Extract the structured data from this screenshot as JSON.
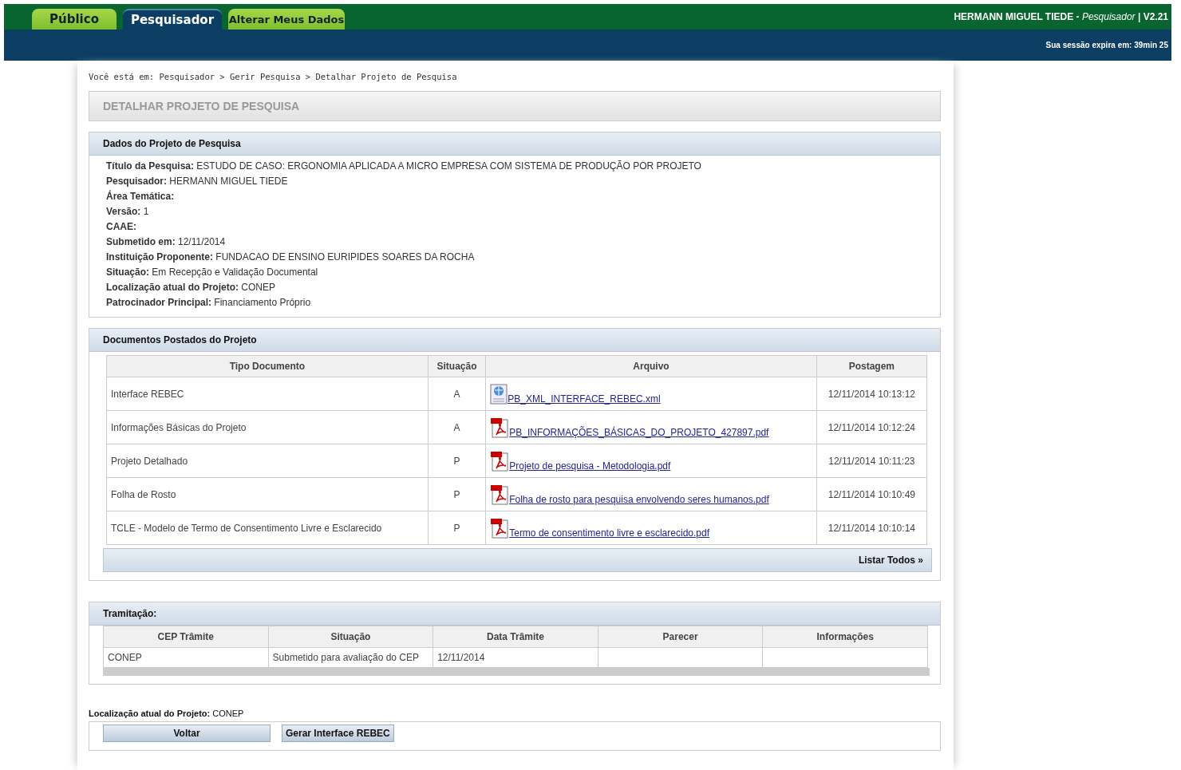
{
  "tabs": [
    {
      "label": "Público",
      "selected": false
    },
    {
      "label": "Pesquisador",
      "selected": true
    },
    {
      "label": "Alterar Meus Dados",
      "selected": false
    }
  ],
  "user": {
    "name": "HERMANN MIGUEL TIEDE",
    "dash": "-",
    "role": "Pesquisador",
    "bar": "|",
    "version": "V2.21",
    "session": "Sua sessão expira em: 39min 25"
  },
  "breadcrumb": "Você está em: Pesquisador > Gerir Pesquisa > Detalhar Projeto de Pesquisa",
  "page_title": "DETALHAR PROJETO DE PESQUISA",
  "project": {
    "title": "Dados do Projeto de Pesquisa",
    "fields": [
      {
        "label": "Título da Pesquisa:",
        "value": "ESTUDO DE CASO: ERGONOMIA APLICADA A MICRO EMPRESA COM SISTEMA DE PRODUÇÃO POR PROJETO"
      },
      {
        "label": "Pesquisador:",
        "value": "HERMANN MIGUEL TIEDE"
      },
      {
        "label": "Área Temática:"
      },
      {
        "label": "Versão:",
        "value": "1"
      },
      {
        "label": "CAAE:"
      },
      {
        "label": "Submetido em:",
        "value": "12/11/2014"
      },
      {
        "label": "Instituição Proponente:",
        "value": "FUNDACAO DE ENSINO EURIPIDES SOARES DA ROCHA"
      },
      {
        "label": "Situação:",
        "value": "Em Recepção e Validação Documental"
      },
      {
        "label": "Localização atual do Projeto:",
        "value": "CONEP"
      },
      {
        "label": "Patrocinador Principal:",
        "value": "Financiamento Próprio"
      }
    ]
  },
  "documents": {
    "title": "Documentos Postados do Projeto",
    "columns": [
      "Tipo Documento",
      "Situação",
      "Arquivo",
      "Postagem"
    ],
    "rows": [
      {
        "type": "Interface REBEC",
        "status": "A",
        "file": "PB_XML_INTERFACE_REBEC.xml",
        "kind": "xml",
        "date": "12/11/2014 10:13:12"
      },
      {
        "type": "Informações Básicas do Projeto",
        "status": "A",
        "file": "PB_INFORMAÇÕES_BÁSICAS_DO_PROJETO_427897.pdf",
        "kind": "pdf",
        "date": "12/11/2014 10:12:24"
      },
      {
        "type": "Projeto Detalhado",
        "status": "P",
        "file": "Projeto de pesquisa - Metodologia.pdf",
        "kind": "pdf",
        "date": "12/11/2014 10:11:23"
      },
      {
        "type": "Folha de Rosto",
        "status": "P",
        "file": "Folha de rosto para pesquisa envolvendo seres humanos.pdf",
        "kind": "pdf",
        "date": "12/11/2014 10:10:49"
      },
      {
        "type": "TCLE - Modelo de Termo de Consentimento Livre e Esclarecido",
        "status": "P",
        "file": "Termo de consentimento livre e esclarecido.pdf",
        "kind": "pdf",
        "date": "12/11/2014 10:10:14"
      }
    ],
    "list_all": "Listar Todos »"
  },
  "tramitacao": {
    "title": "Tramitação:",
    "columns": [
      "CEP Trâmite",
      "Situação",
      "Data Trâmite",
      "Parecer",
      "Informações"
    ],
    "rows": [
      [
        "CONEP",
        "Submetido para avaliação do CEP",
        "12/11/2014",
        "",
        ""
      ]
    ]
  },
  "location": {
    "label": "Localização atual do Projeto:",
    "value": "CONEP"
  },
  "buttons": [
    "Voltar",
    "Gerar Interface REBEC"
  ]
}
